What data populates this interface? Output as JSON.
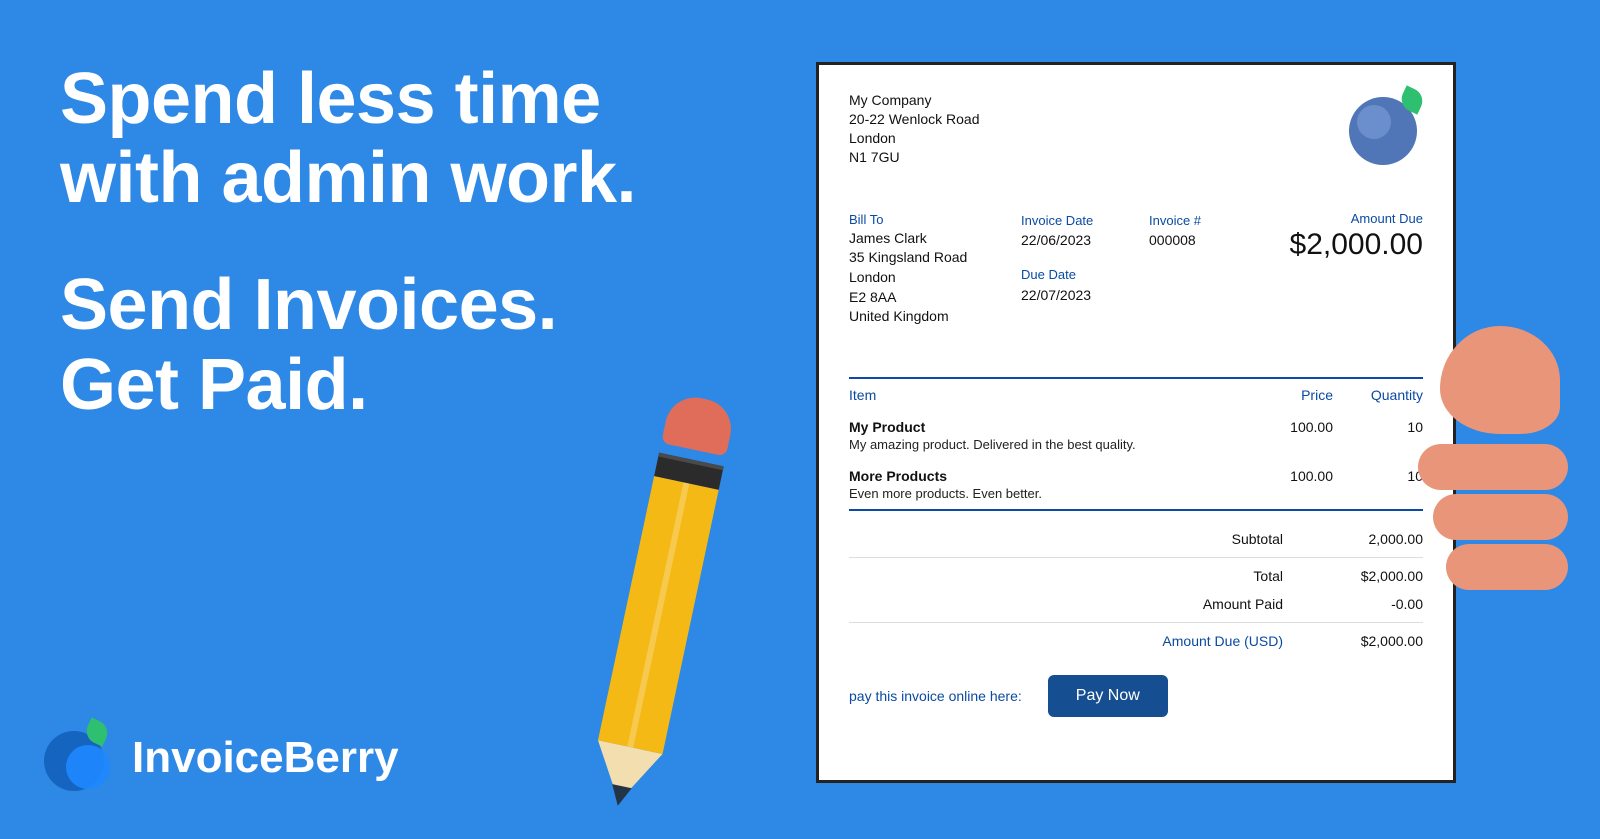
{
  "headline": {
    "line1": "Spend less time with admin work.",
    "line2": "Send Invoices. Get Paid."
  },
  "brand": {
    "name": "InvoiceBerry"
  },
  "invoice": {
    "company": {
      "name": "My Company",
      "address1": "20-22 Wenlock Road",
      "city": "London",
      "postcode": "N1 7GU"
    },
    "labels": {
      "bill_to": "Bill To",
      "invoice_date": "Invoice Date",
      "due_date": "Due Date",
      "invoice_no": "Invoice #",
      "amount_due": "Amount Due",
      "item": "Item",
      "price": "Price",
      "quantity": "Quantity",
      "subtotal": "Subtotal",
      "total": "Total",
      "amount_paid": "Amount Paid",
      "amount_due_usd": "Amount Due (USD)"
    },
    "bill_to": {
      "name": "James Clark",
      "address1": "35 Kingsland Road",
      "city": "London",
      "postcode": "E2 8AA",
      "country": "United Kingdom"
    },
    "dates": {
      "invoice": "22/06/2023",
      "due": "22/07/2023"
    },
    "number": "000008",
    "amount_due_display": "$2,000.00",
    "items": [
      {
        "name": "My Product",
        "desc": "My amazing product. Delivered in the best quality.",
        "price": "100.00",
        "qty": "10"
      },
      {
        "name": "More Products",
        "desc": "Even more products. Even better.",
        "price": "100.00",
        "qty": "10"
      }
    ],
    "totals": {
      "subtotal": "2,000.00",
      "total": "$2,000.00",
      "paid": "-0.00",
      "due": "$2,000.00"
    },
    "pay": {
      "prompt_visible": "pay this invoice online here:",
      "button": "Pay Now"
    }
  }
}
